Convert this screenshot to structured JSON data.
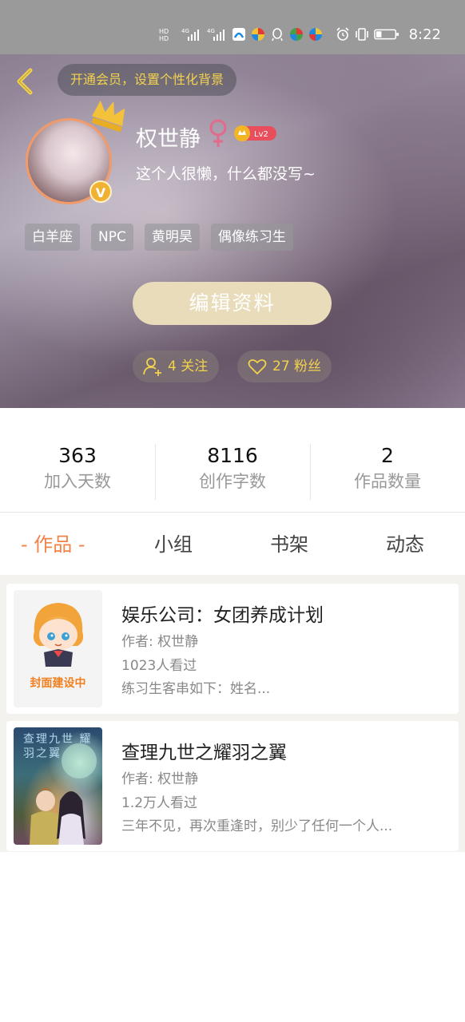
{
  "status_bar": {
    "signal_labels": [
      "HD",
      "HD",
      "4G",
      "4G"
    ],
    "time": "8:22"
  },
  "header": {
    "vip_banner": "开通会员，设置个性化背景"
  },
  "profile": {
    "username": "权世静",
    "level": "Lv2",
    "bio": "这个人很懒，什么都没写~",
    "tags": [
      "白羊座",
      "NPC",
      "黄明昊",
      "偶像练习生"
    ],
    "edit_button": "编辑资料",
    "follows": "4 关注",
    "fans": "27 粉丝"
  },
  "stats": [
    {
      "value": "363",
      "label": "加入天数"
    },
    {
      "value": "8116",
      "label": "创作字数"
    },
    {
      "value": "2",
      "label": "作品数量"
    }
  ],
  "tabs": [
    "- 作品 -",
    "小组",
    "书架",
    "动态"
  ],
  "works": [
    {
      "cover_text": "封面建设中",
      "title": "娱乐公司：女团养成计划",
      "author": "作者: 权世静",
      "views": "1023人看过",
      "desc": "练习生客串如下：姓名..."
    },
    {
      "cover_text": "查理九世 耀羽之翼",
      "title": "查理九世之耀羽之翼",
      "author": "作者: 权世静",
      "views": "1.2万人看过",
      "desc": "三年不见，再次重逢时，别少了任何一个人..."
    }
  ],
  "colors": {
    "accent": "#f0834a",
    "vip_yellow": "#f3d24c",
    "edit_button": "#e9dcba"
  }
}
